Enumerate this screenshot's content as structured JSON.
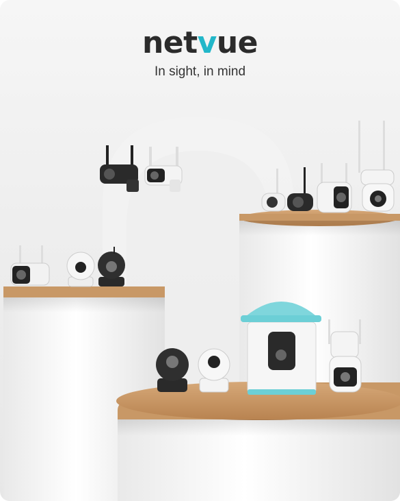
{
  "brand": {
    "logo_pre": "net",
    "logo_accent": "v",
    "logo_post": "ue",
    "tagline": "In sight, in mind",
    "accent_color": "#22b7c9"
  },
  "products": {
    "pedestal_color": "#c89866",
    "icons": [
      "bullet-camera-icon",
      "pan-tilt-camera-icon",
      "bird-feeder-camera-icon",
      "ptz-outdoor-camera-icon"
    ]
  }
}
